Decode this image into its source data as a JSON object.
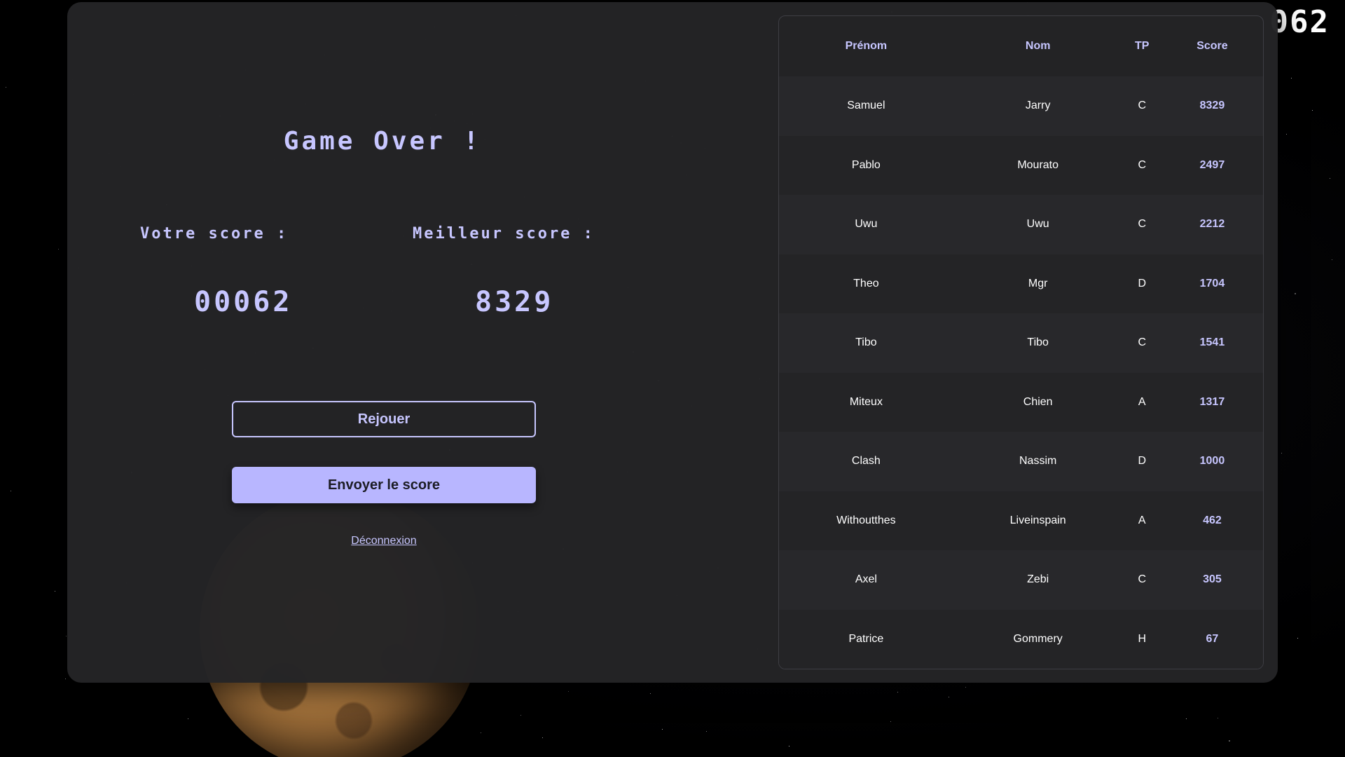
{
  "corner_score": "062",
  "game": {
    "title": "Game Over !",
    "your_score_label": "Votre score :",
    "your_score": "00062",
    "best_score_label": "Meilleur score :",
    "best_score": "8329"
  },
  "actions": {
    "replay_label": "Rejouer",
    "send_label": "Envoyer le score",
    "logout_label": "Déconnexion"
  },
  "leaderboard": {
    "headers": {
      "prenom": "Prénom",
      "nom": "Nom",
      "tp": "TP",
      "score": "Score"
    },
    "rows": [
      {
        "prenom": "Samuel",
        "nom": "Jarry",
        "tp": "C",
        "score": "8329"
      },
      {
        "prenom": "Pablo",
        "nom": "Mourato",
        "tp": "C",
        "score": "2497"
      },
      {
        "prenom": "Uwu",
        "nom": "Uwu",
        "tp": "C",
        "score": "2212"
      },
      {
        "prenom": "Theo",
        "nom": "Mgr",
        "tp": "D",
        "score": "1704"
      },
      {
        "prenom": "Tibo",
        "nom": "Tibo",
        "tp": "C",
        "score": "1541"
      },
      {
        "prenom": "Miteux",
        "nom": "Chien",
        "tp": "A",
        "score": "1317"
      },
      {
        "prenom": "Clash",
        "nom": "Nassim",
        "tp": "D",
        "score": "1000"
      },
      {
        "prenom": "Withoutthes",
        "nom": "Liveinspain",
        "tp": "A",
        "score": "462"
      },
      {
        "prenom": "Axel",
        "nom": "Zebi",
        "tp": "C",
        "score": "305"
      },
      {
        "prenom": "Patrice",
        "nom": "Gommery",
        "tp": "H",
        "score": "67"
      }
    ]
  },
  "colors": {
    "accent": "#c7c6ff",
    "button_fill": "#b8b6ff",
    "panel": "#242426"
  }
}
